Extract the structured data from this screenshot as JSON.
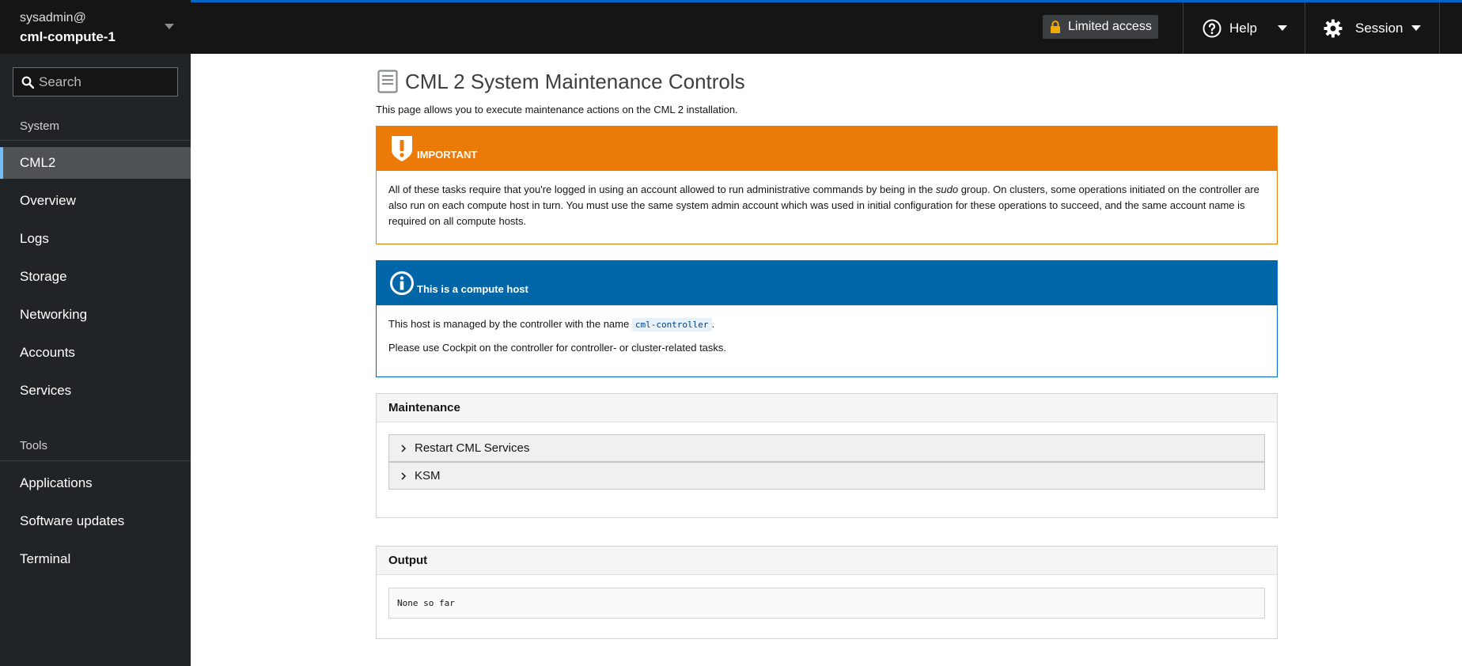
{
  "host_switcher": {
    "user": "sysadmin@",
    "host": "cml-compute-1"
  },
  "search": {
    "placeholder": "Search"
  },
  "sidebar": {
    "system_title": "System",
    "system_items": [
      {
        "label": "CML2",
        "active": true
      },
      {
        "label": "Overview"
      },
      {
        "label": "Logs"
      },
      {
        "label": "Storage"
      },
      {
        "label": "Networking"
      },
      {
        "label": "Accounts"
      },
      {
        "label": "Services"
      }
    ],
    "tools_title": "Tools",
    "tools_items": [
      {
        "label": "Applications"
      },
      {
        "label": "Software updates"
      },
      {
        "label": "Terminal"
      }
    ]
  },
  "topbar": {
    "limited_access": "Limited access",
    "help": "Help",
    "session": "Session"
  },
  "page": {
    "title": "CML 2 System Maintenance Controls",
    "description": "This page allows you to execute maintenance actions on the CML 2 installation."
  },
  "important": {
    "title": "IMPORTANT",
    "text_before": "All of these tasks require that you're logged in using an account allowed to run administrative commands by being in the ",
    "text_em": "sudo",
    "text_after": " group. On clusters, some operations initiated on the controller are also run on each compute host in turn. You must use the same system admin account which was used in initial configuration for these operations to succeed, and the same account name is required on all compute hosts."
  },
  "compute_host": {
    "title": "This is a compute host",
    "line1_before": "This host is managed by the controller with the name ",
    "controller_name": "cml-controller",
    "line1_after": ".",
    "line2": "Please use Cockpit on the controller for controller- or cluster-related tasks."
  },
  "maintenance": {
    "title": "Maintenance",
    "items": [
      "Restart CML Services",
      "KSM"
    ]
  },
  "output": {
    "title": "Output",
    "value": "None so far"
  },
  "colors": {
    "warning": "#ec7a08",
    "info": "#0066a8",
    "active_nav": "#73bcf7"
  }
}
